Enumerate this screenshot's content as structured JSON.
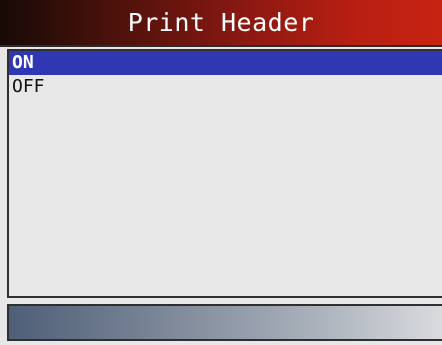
{
  "header": {
    "title": "Print Header"
  },
  "menu": {
    "items": [
      {
        "label": "ON",
        "selected": true
      },
      {
        "label": "OFF",
        "selected": false
      }
    ]
  },
  "colors": {
    "title_bar_gradient_start": "#170a07",
    "title_bar_gradient_end": "#c72313",
    "selection_highlight": "#2f37b5",
    "status_bar_gradient_start": "#4f5f78",
    "status_bar_gradient_end": "#d9dbde",
    "screen_background": "#e8e8e8"
  }
}
